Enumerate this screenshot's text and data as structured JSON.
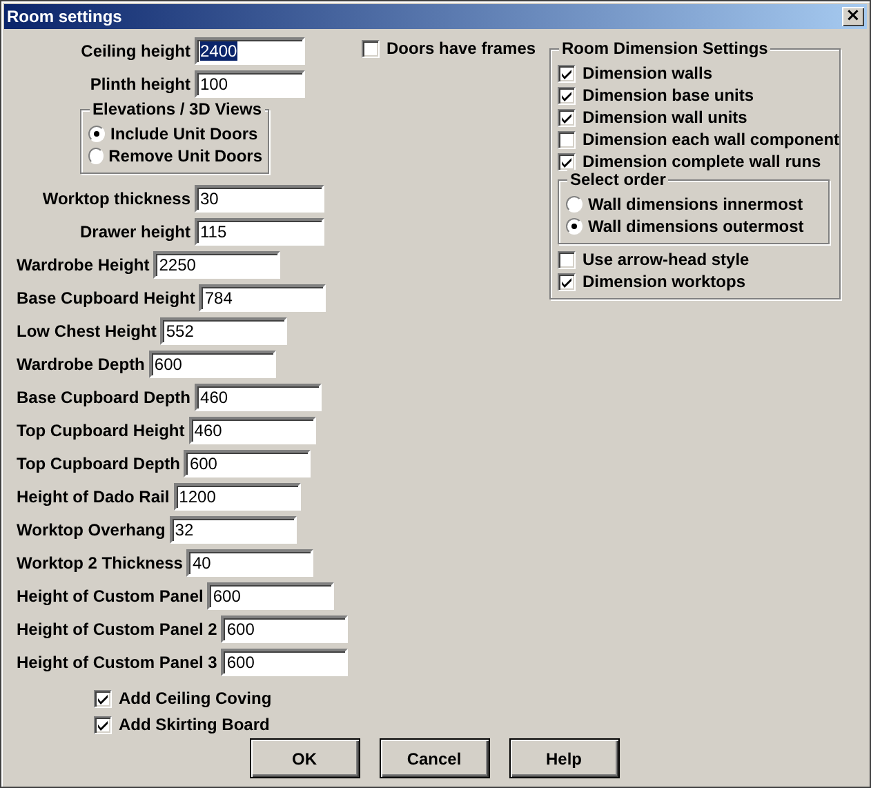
{
  "window": {
    "title": "Room settings",
    "close": "×"
  },
  "top_fields": [
    {
      "label": "Ceiling height",
      "value": "2400",
      "text_selected": true
    },
    {
      "label": "Plinth height",
      "value": "100",
      "text_selected": false
    }
  ],
  "elevations": {
    "title": "Elevations / 3D Views",
    "options": [
      {
        "label": "Include Unit Doors",
        "selected": true
      },
      {
        "label": "Remove Unit Doors",
        "selected": false
      }
    ]
  },
  "mid_fields": [
    {
      "label": "Worktop thickness",
      "value": "30"
    },
    {
      "label": "Drawer height",
      "value": "115"
    }
  ],
  "fields": [
    {
      "label": "Wardrobe Height",
      "value": "2250"
    },
    {
      "label": "Base Cupboard Height",
      "value": "784"
    },
    {
      "label": "Low Chest Height",
      "value": "552"
    },
    {
      "label": "Wardrobe Depth",
      "value": "600"
    },
    {
      "label": "Base Cupboard Depth",
      "value": "460"
    },
    {
      "label": "Top Cupboard Height",
      "value": "460"
    },
    {
      "label": "Top Cupboard Depth",
      "value": "600"
    },
    {
      "label": "Height of Dado Rail",
      "value": "1200"
    },
    {
      "label": "Worktop Overhang",
      "value": "32"
    },
    {
      "label": "Worktop 2 Thickness",
      "value": "40"
    },
    {
      "label": "Height of Custom Panel",
      "value": "600"
    },
    {
      "label": "Height of Custom Panel 2",
      "value": "600"
    },
    {
      "label": "Height of Custom Panel 3",
      "value": "600"
    }
  ],
  "bottom_checks": [
    {
      "label": "Add Ceiling Coving",
      "checked": true
    },
    {
      "label": "Add Skirting Board",
      "checked": true
    }
  ],
  "doors_have_frames": {
    "label": "Doors have frames",
    "checked": false
  },
  "dimension_settings": {
    "title": "Room Dimension Settings",
    "checks": [
      {
        "label": "Dimension walls",
        "checked": true
      },
      {
        "label": "Dimension base units",
        "checked": true
      },
      {
        "label": "Dimension wall units",
        "checked": true
      },
      {
        "label": "Dimension each wall component",
        "checked": false
      },
      {
        "label": "Dimension complete wall runs",
        "checked": true
      }
    ],
    "order": {
      "title": "Select order",
      "options": [
        {
          "label": "Wall dimensions innermost",
          "selected": false
        },
        {
          "label": "Wall dimensions outermost",
          "selected": true
        }
      ]
    },
    "checks_after": [
      {
        "label": "Use arrow-head style",
        "checked": false
      },
      {
        "label": "Dimension worktops",
        "checked": true
      }
    ]
  },
  "buttons": [
    "OK",
    "Cancel",
    "Help"
  ]
}
